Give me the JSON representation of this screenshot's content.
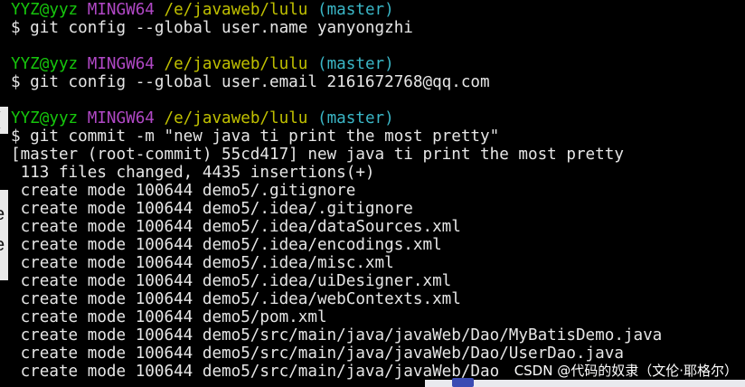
{
  "prompt_user": "YYZ@yyz",
  "prompt_system": "MINGW64",
  "prompt_path": "/e/javaweb/lulu",
  "prompt_branch": "(master)",
  "commands": [
    "$ git config --global user.name yanyongzhi",
    "$ git config --global user.email 2161672768@qq.com",
    "$ git commit -m \"new java ti print the most pretty\""
  ],
  "commit_summary": "[master (root-commit) 55cd417] new java ti print the most pretty",
  "commit_stats": " 113 files changed, 4435 insertions(+)",
  "create_lines": [
    " create mode 100644 demo5/.gitignore",
    " create mode 100644 demo5/.idea/.gitignore",
    " create mode 100644 demo5/.idea/dataSources.xml",
    " create mode 100644 demo5/.idea/encodings.xml",
    " create mode 100644 demo5/.idea/misc.xml",
    " create mode 100644 demo5/.idea/uiDesigner.xml",
    " create mode 100644 demo5/.idea/webContexts.xml",
    " create mode 100644 demo5/pom.xml",
    " create mode 100644 demo5/src/main/java/javaWeb/Dao/MyBatisDemo.java",
    " create mode 100644 demo5/src/main/java/javaWeb/Dao/UserDao.java",
    " create mode 100644 demo5/src/main/java/javaWeb/Dao"
  ],
  "watermark": "CSDN @代码的奴隶（文伦·耶格尔）",
  "colors": {
    "background": "#000000",
    "user": "#16c60c",
    "system": "#b148c6",
    "path": "#c0c000",
    "branch": "#3ab6c6",
    "text": "#e6e6e6"
  }
}
